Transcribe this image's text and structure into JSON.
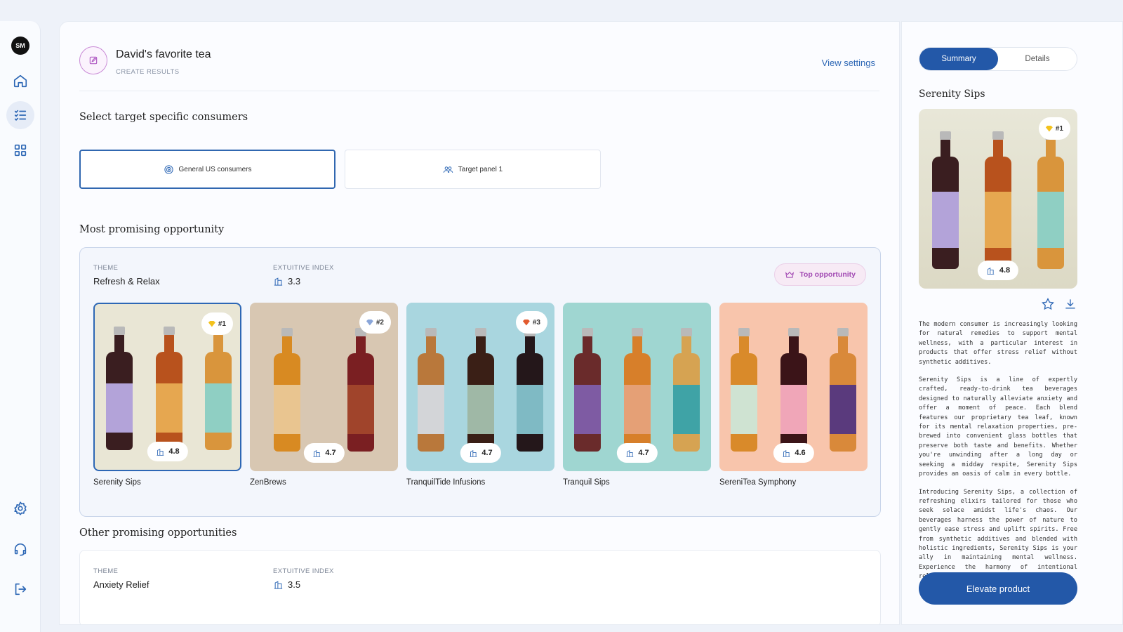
{
  "sidebar": {
    "avatar_initials": "SM",
    "items": [
      {
        "icon": "home-icon"
      },
      {
        "icon": "checklist-icon",
        "active": true
      },
      {
        "icon": "grid-icon"
      }
    ],
    "bottom_items": [
      {
        "icon": "gear-icon"
      },
      {
        "icon": "headset-icon"
      },
      {
        "icon": "logout-icon"
      }
    ]
  },
  "header": {
    "title": "David's favorite tea",
    "subtitle": "CREATE RESULTS",
    "view_settings": "View settings"
  },
  "consumers": {
    "heading": "Select target specific consumers",
    "options": [
      {
        "label": "General US consumers",
        "icon": "target-icon",
        "selected": true
      },
      {
        "label": "Target panel 1",
        "icon": "people-icon",
        "selected": false
      }
    ]
  },
  "most_promising": {
    "heading": "Most promising opportunity",
    "theme_label": "THEME",
    "theme_value": "Refresh & Relax",
    "index_label": "EXTUITIVE INDEX",
    "index_value": "3.3",
    "top_badge": "Top opportunity",
    "products": [
      {
        "name": "Serenity Sips",
        "rank": "#1",
        "score": "4.8",
        "gem_color": "#f3c21d",
        "bg": "#e9e6d5",
        "bottles": [
          "#3a1e20",
          "#b8521d",
          "#d9953c"
        ],
        "labels": [
          "#b3a3d9",
          "#e6a750",
          "#8fcfc3"
        ]
      },
      {
        "name": "ZenBrews",
        "rank": "#2",
        "score": "4.7",
        "gem_color": "#8aa6d9",
        "bg": "#d8c7b2",
        "bottles": [
          "#d88a22",
          "#7a1f22"
        ],
        "labels": [
          "#e9c590",
          "#a0442b"
        ]
      },
      {
        "name": "TranquilTide Infusions",
        "rank": "#3",
        "score": "4.7",
        "gem_color": "#e25a2e",
        "bg": "#a9d6df",
        "bottles": [
          "#b9783b",
          "#3a1f16",
          "#24171a"
        ],
        "labels": [
          "#d3d5d8",
          "#9fb8a6",
          "#7fbac4"
        ]
      },
      {
        "name": "Tranquil Sips",
        "rank": "",
        "score": "4.7",
        "gem_color": "",
        "bg": "#9fd6d1",
        "bottles": [
          "#6a2b2b",
          "#d77f2a",
          "#d6a352"
        ],
        "labels": [
          "#7e5ba3",
          "#e5a076",
          "#3fa3a6"
        ]
      },
      {
        "name": "SereniTea Symphony",
        "rank": "",
        "score": "4.6",
        "gem_color": "",
        "bg": "#f8c5ac",
        "bottles": [
          "#d98a2a",
          "#3b1418",
          "#d9893a"
        ],
        "labels": [
          "#cfe3d2",
          "#f0a6b8",
          "#5a3a7d"
        ]
      }
    ]
  },
  "other": {
    "heading": "Other promising opportunities",
    "theme_label": "THEME",
    "theme_value": "Anxiety Relief",
    "index_label": "EXTUITIVE INDEX",
    "index_value": "3.5"
  },
  "detail": {
    "tabs": [
      "Summary",
      "Details"
    ],
    "title": "Serenity Sips",
    "rank": "#1",
    "score": "4.8",
    "paragraphs": [
      "The modern consumer is increasingly looking for natural remedies to support mental wellness, with a particular interest in products that offer stress relief without synthetic additives.",
      "Serenity Sips is a line of expertly crafted, ready-to-drink tea beverages designed to naturally alleviate anxiety and offer a moment of peace. Each blend features our proprietary tea leaf, known for its mental relaxation properties, pre-brewed into convenient glass bottles that preserve both taste and benefits. Whether you're unwinding after a long day or seeking a midday respite, Serenity Sips provides an oasis of calm in every bottle.",
      "Introducing Serenity Sips, a collection of refreshing elixirs tailored for those who seek solace amidst life's chaos. Our beverages harness the power of nature to gently ease stress and uplift spirits. Free from synthetic additives and blended with holistic ingredients, Serenity Sips is your ally in maintaining mental wellness. Experience the harmony of intentional relaxation, bottled for your convenience."
    ],
    "cta": "Elevate product"
  }
}
